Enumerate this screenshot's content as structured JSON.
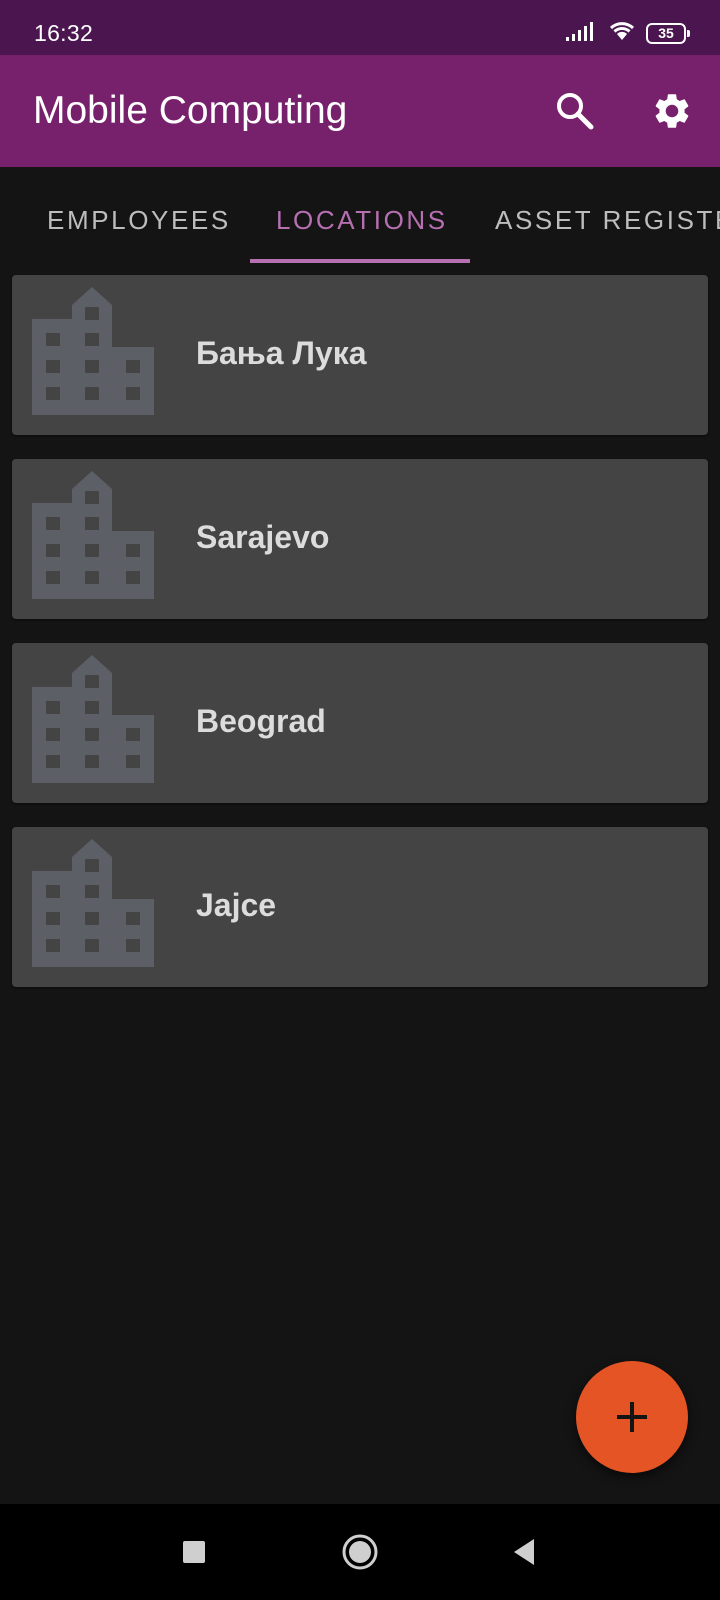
{
  "status_bar": {
    "time": "16:32",
    "battery": "35",
    "icons": [
      "signal-icon",
      "wifi-icon",
      "battery-icon"
    ]
  },
  "app_bar": {
    "title": "Mobile Computing",
    "actions": [
      "search-icon",
      "gear-icon"
    ]
  },
  "tabs": [
    {
      "label": "EMPLOYEES",
      "selected": false
    },
    {
      "label": "LOCATIONS",
      "selected": true
    },
    {
      "label": "ASSET REGISTER",
      "selected": false
    }
  ],
  "locations": [
    {
      "name": "Бања Лука",
      "icon": "building-icon"
    },
    {
      "name": "Sarajevo",
      "icon": "building-icon"
    },
    {
      "name": "Beograd",
      "icon": "building-icon"
    },
    {
      "name": "Jajce",
      "icon": "building-icon"
    }
  ],
  "fab": {
    "icon": "plus-icon"
  },
  "nav_bar": {
    "buttons": [
      "recents-icon",
      "home-icon",
      "back-icon"
    ]
  },
  "colors": {
    "status_bar": "#4b1650",
    "app_bar": "#77206b",
    "tab_active": "#b66fb1",
    "background": "#141414",
    "card": "#444444",
    "fab": "#e45424"
  }
}
